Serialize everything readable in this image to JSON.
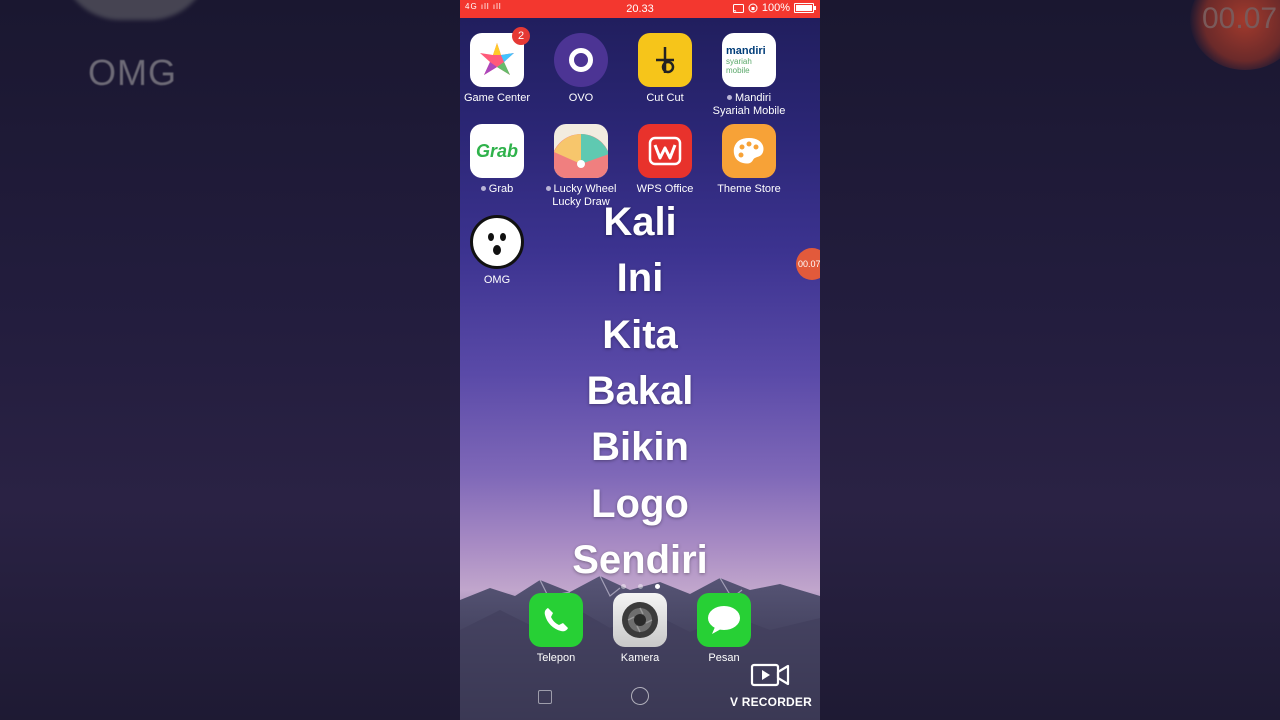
{
  "background": {
    "side_label": "OMG",
    "side_timer": "00.07"
  },
  "statusbar": {
    "signal": "4G ıll ıll",
    "time": "20.33",
    "battery": "100%",
    "battery_level": 1.0
  },
  "apps": [
    {
      "label": "Game Center",
      "icon": "game-center-icon",
      "badge": "2"
    },
    {
      "label": "OVO",
      "icon": "ovo-icon"
    },
    {
      "label": "Cut Cut",
      "icon": "cut-cut-icon"
    },
    {
      "label": "Mandiri Syariah Mobile",
      "icon": "mandiri-syariah-icon",
      "icon_text": "mandiri",
      "icon_subtext": "syariah mobile",
      "dot": true
    },
    {
      "label": "Grab",
      "icon": "grab-icon",
      "icon_text": "Grab",
      "dot": true
    },
    {
      "label": "Lucky Wheel Lucky Draw",
      "icon": "lucky-wheel-icon",
      "dot": true
    },
    {
      "label": "WPS Office",
      "icon": "wps-office-icon"
    },
    {
      "label": "Theme Store",
      "icon": "theme-store-icon"
    },
    {
      "label": "OMG",
      "icon": "omg-icon"
    }
  ],
  "overlay_lines": [
    "Kali",
    "Ini",
    "Kita",
    "Bakal",
    "Bikin",
    "Logo",
    "Sendiri"
  ],
  "recording_timer": "00.07",
  "dock": [
    {
      "label": "Telepon",
      "icon": "phone-icon"
    },
    {
      "label": "Kamera",
      "icon": "camera-icon"
    },
    {
      "label": "Pesan",
      "icon": "message-icon"
    }
  ],
  "watermark": "V RECORDER",
  "colors": {
    "statusbar": "#f3372f",
    "accent_green": "#27d035",
    "wps_red": "#e8322c",
    "cutcut_yellow": "#f6c51a"
  }
}
